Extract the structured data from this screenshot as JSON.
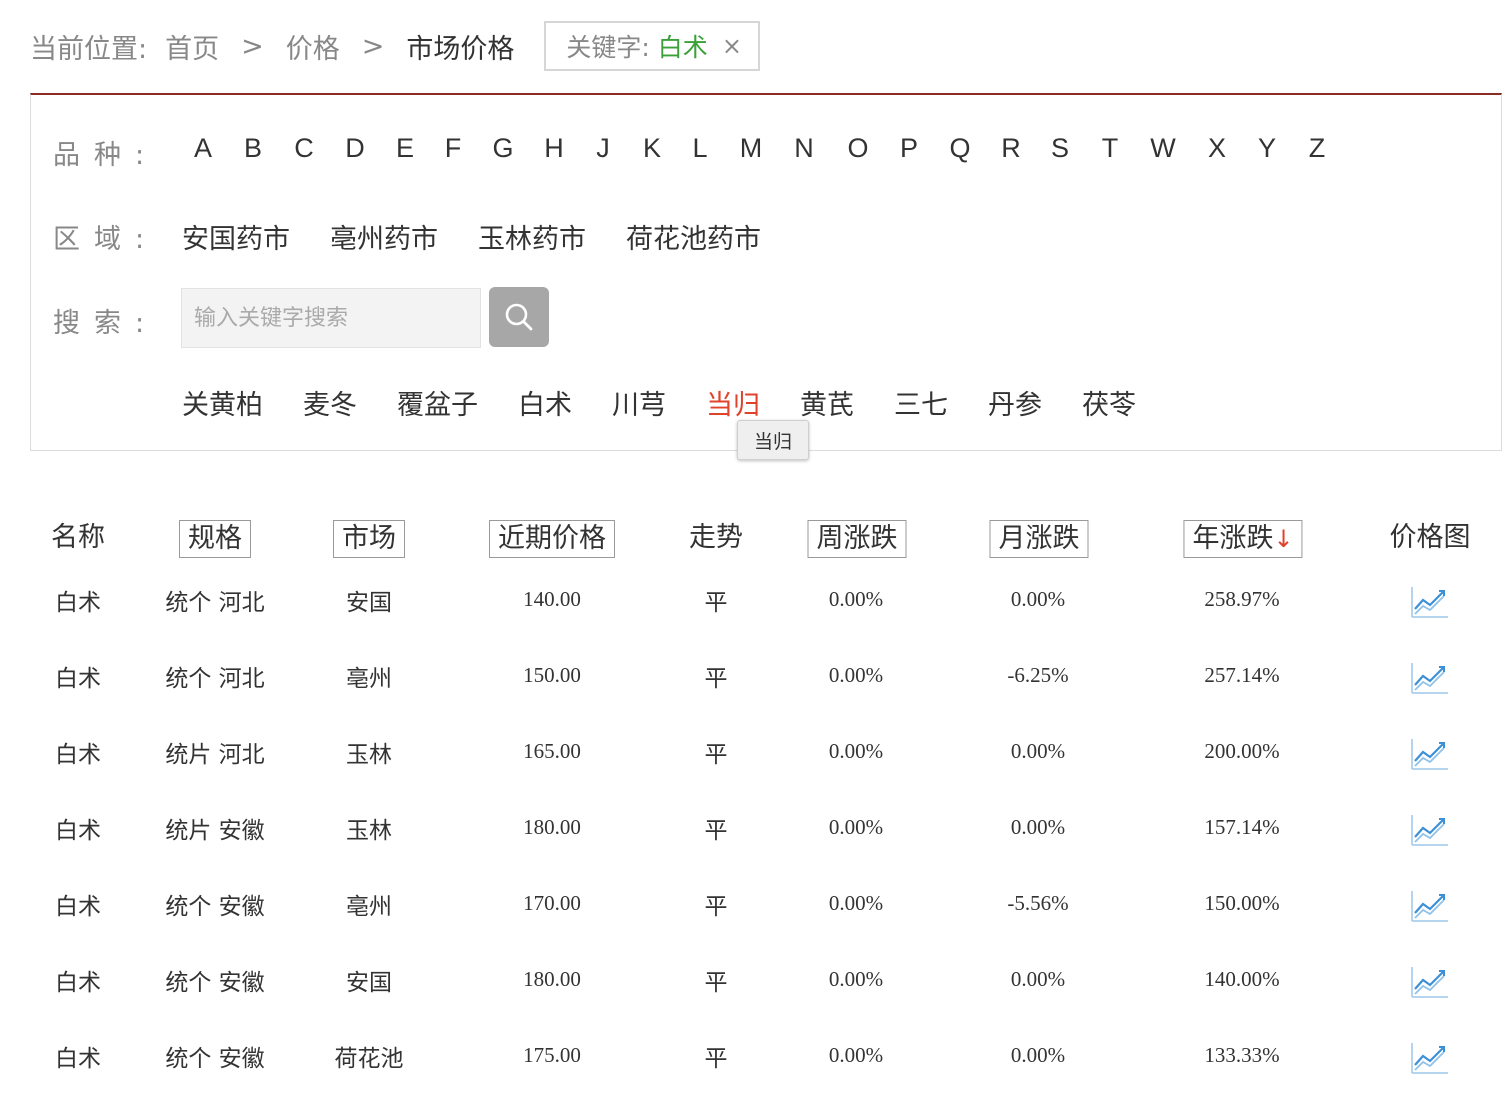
{
  "breadcrumb": {
    "prefix": "当前位置:",
    "items": [
      "首页",
      "价格",
      "市场价格"
    ],
    "separator": ">"
  },
  "keyword_filter": {
    "label": "关键字:",
    "value": "白术",
    "close": "×"
  },
  "filters": {
    "variety_label": "品种:",
    "letters": [
      "A",
      "B",
      "C",
      "D",
      "E",
      "F",
      "G",
      "H",
      "J",
      "K",
      "L",
      "M",
      "N",
      "O",
      "P",
      "Q",
      "R",
      "S",
      "T",
      "W",
      "X",
      "Y",
      "Z"
    ],
    "region_label": "区域:",
    "markets": [
      "安国药市",
      "亳州药市",
      "玉林药市",
      "荷花池药市"
    ],
    "search_label": "搜索:",
    "search_placeholder": "输入关键字搜索",
    "search_icon": "search-icon",
    "hot_keywords": [
      "关黄柏",
      "麦冬",
      "覆盆子",
      "白术",
      "川芎",
      "当归",
      "黄芪",
      "三七",
      "丹参",
      "茯苓"
    ],
    "active_keyword": "当归",
    "tooltip": "当归"
  },
  "table": {
    "headers": {
      "name": "名称",
      "spec": "规格",
      "market": "市场",
      "price": "近期价格",
      "trend": "走势",
      "week": "周涨跌",
      "month": "月涨跌",
      "year": "年涨跌",
      "year_sort": "↓",
      "chart": "价格图"
    },
    "rows": [
      {
        "name": "白术",
        "spec": "统个 河北",
        "market": "安国",
        "price": "140.00",
        "trend": "平",
        "week": "0.00%",
        "month": "0.00%",
        "year": "258.97%"
      },
      {
        "name": "白术",
        "spec": "统个 河北",
        "market": "亳州",
        "price": "150.00",
        "trend": "平",
        "week": "0.00%",
        "month": "-6.25%",
        "year": "257.14%"
      },
      {
        "name": "白术",
        "spec": "统片 河北",
        "market": "玉林",
        "price": "165.00",
        "trend": "平",
        "week": "0.00%",
        "month": "0.00%",
        "year": "200.00%"
      },
      {
        "name": "白术",
        "spec": "统片 安徽",
        "market": "玉林",
        "price": "180.00",
        "trend": "平",
        "week": "0.00%",
        "month": "0.00%",
        "year": "157.14%"
      },
      {
        "name": "白术",
        "spec": "统个 安徽",
        "market": "亳州",
        "price": "170.00",
        "trend": "平",
        "week": "0.00%",
        "month": "-5.56%",
        "year": "150.00%"
      },
      {
        "name": "白术",
        "spec": "统个 安徽",
        "market": "安国",
        "price": "180.00",
        "trend": "平",
        "week": "0.00%",
        "month": "0.00%",
        "year": "140.00%"
      },
      {
        "name": "白术",
        "spec": "统个 安徽",
        "market": "荷花池",
        "price": "175.00",
        "trend": "平",
        "week": "0.00%",
        "month": "0.00%",
        "year": "133.33%"
      }
    ],
    "chart_icon": "price-chart-icon"
  },
  "colors": {
    "accent_line": "#8b2c22",
    "active": "#e0432b",
    "keyword": "#3aa13a",
    "chart_icon": "#3d8fd6"
  }
}
